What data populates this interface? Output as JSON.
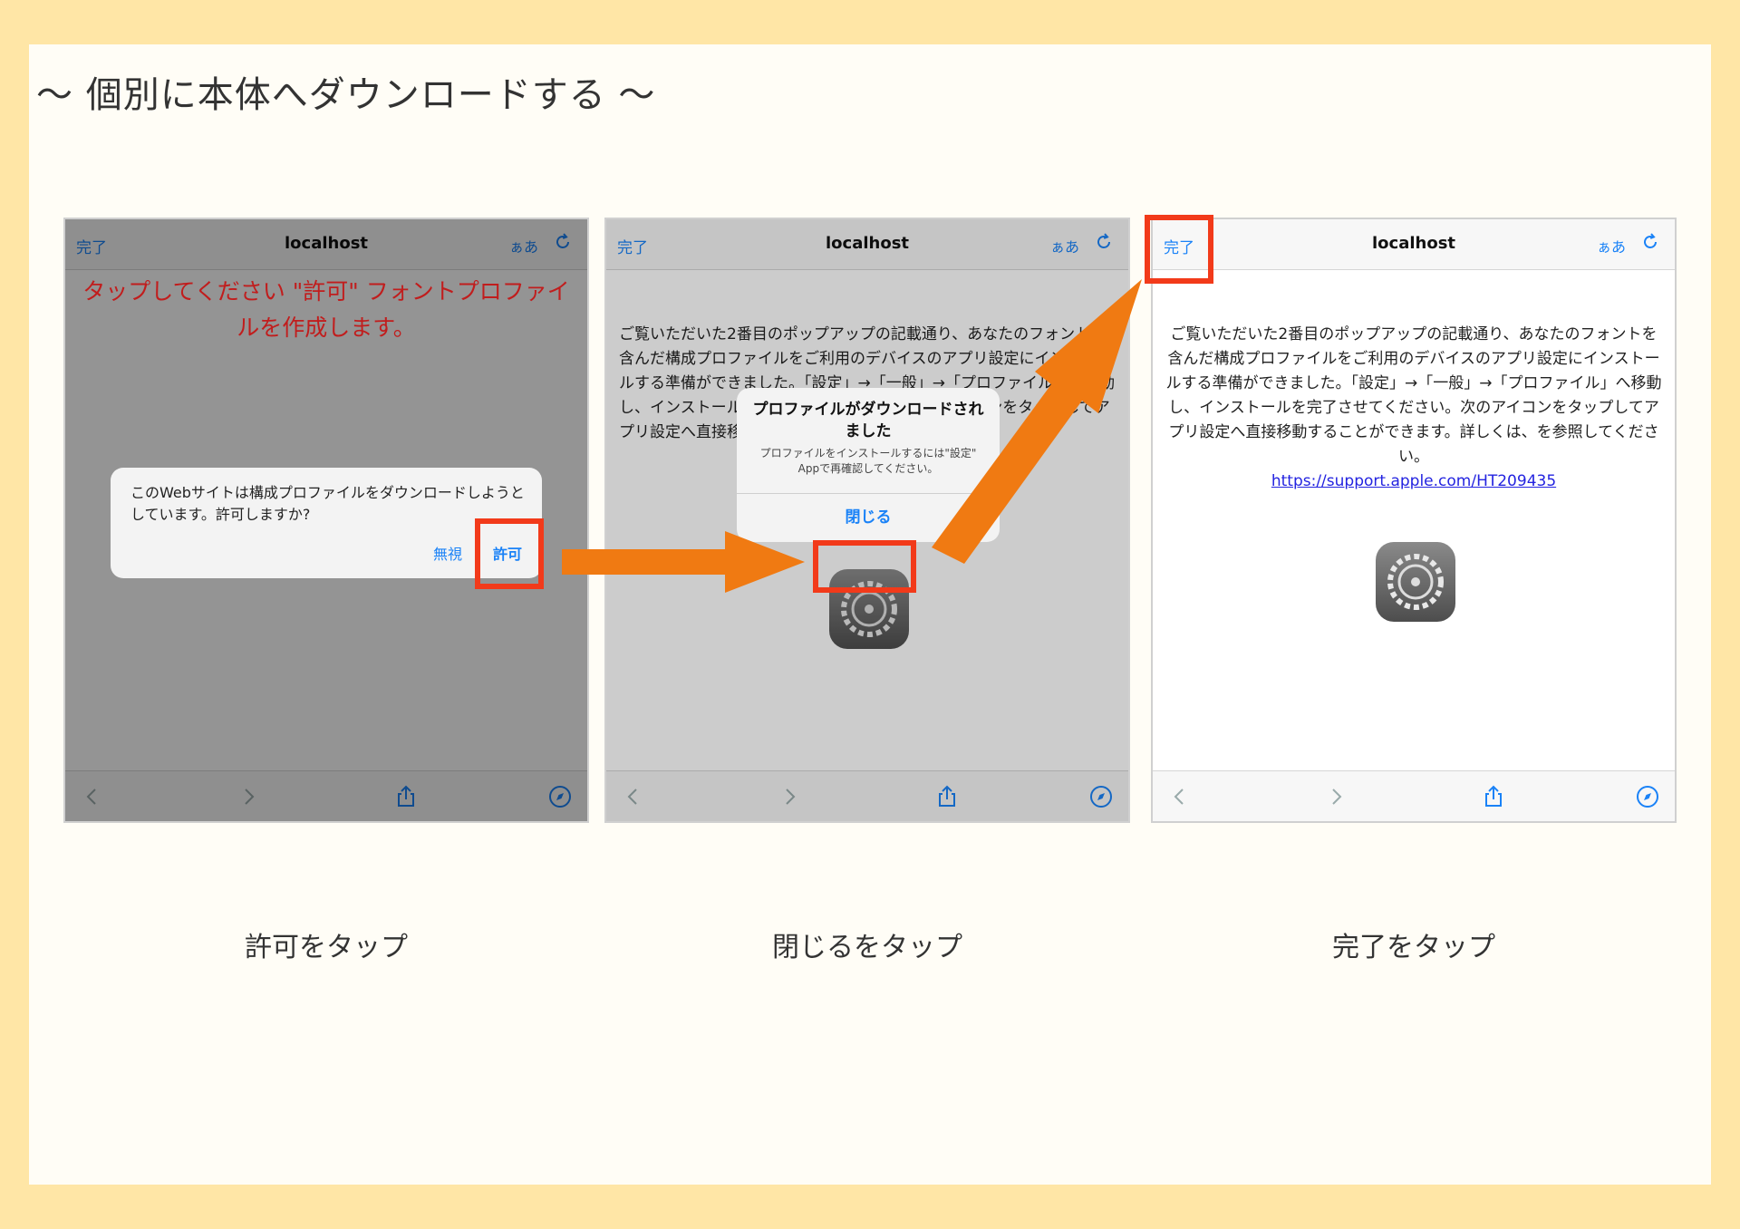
{
  "title": "〜 個別に本体へダウンロードする 〜",
  "browser": {
    "done_label": "完了",
    "host": "localhost",
    "text_size_label": "ぁあ"
  },
  "step1": {
    "message": "タップしてください \"許可\" フォントプロファイルを作成します。",
    "dialog_message": "このWebサイトは構成プロファイルをダウンロードしようとしています。許可しますか?",
    "ignore_label": "無視",
    "allow_label": "許可",
    "caption": "許可をタップ"
  },
  "step2": {
    "body": "ご覧いただいた2番目のポップアップの記載通り、あなたのフォントを含んだ構成プロファイルをご利用のデバイスのアプリ設定にインストールする準備ができました。「設定」→「一般」→「プロファイル」へ移動し、インストールを完了させてください。次のアイコンをタップしてアプリ設定へ直接移動することができます。詳し",
    "dialog_title": "プロファイルがダウンロードされました",
    "dialog_sub": "プロファイルをインストールするには\"設定\" Appで再確認してください。",
    "close_label": "閉じる",
    "caption": "閉じるをタップ"
  },
  "step3": {
    "body": "ご覧いただいた2番目のポップアップの記載通り、あなたのフォントを含んだ構成プロファイルをご利用のデバイスのアプリ設定にインストールする準備ができました。「設定」→「一般」→「プロファイル」へ移動し、インストールを完了させてください。次のアイコンをタップしてアプリ設定へ直接移動することができます。詳しくは、を参照してください。",
    "link": "https://support.apple.com/HT209435",
    "caption": "完了をタップ"
  },
  "colors": {
    "highlight": "#f23a1a",
    "arrow": "#f07a12",
    "ios_blue": "#1a82f7",
    "warning_red": "#c11d1d",
    "page_bg": "#ffe6a6"
  }
}
